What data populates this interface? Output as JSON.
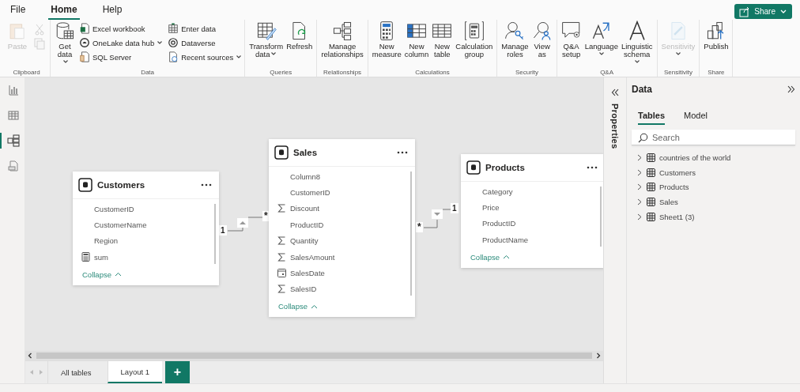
{
  "menu": [
    {
      "label": "File",
      "selected": false
    },
    {
      "label": "Home",
      "selected": true
    },
    {
      "label": "Help",
      "selected": false
    }
  ],
  "share_button": {
    "label": "Share"
  },
  "ribbon": [
    {
      "label": "Clipboard",
      "buttons": [
        {
          "kind": "large",
          "label": "Paste",
          "disabled": true,
          "dropdown": false
        },
        {
          "kind": "icon",
          "disabled": true
        },
        {
          "kind": "icon",
          "disabled": true
        }
      ]
    },
    {
      "label": "Data",
      "buttons": [
        {
          "kind": "large",
          "label": "Get data",
          "disabled": false,
          "dropdown": true
        },
        {
          "kind": "small",
          "label": "Excel workbook",
          "disabled": false,
          "dropdown": false
        },
        {
          "kind": "small",
          "label": "OneLake data hub",
          "disabled": false,
          "dropdown": true
        },
        {
          "kind": "small",
          "label": "SQL Server",
          "disabled": false,
          "dropdown": false
        },
        {
          "kind": "small",
          "label": "Enter data",
          "disabled": false,
          "dropdown": false
        },
        {
          "kind": "small",
          "label": "Dataverse",
          "disabled": false,
          "dropdown": false
        },
        {
          "kind": "small",
          "label": "Recent sources",
          "disabled": false,
          "dropdown": true
        }
      ]
    },
    {
      "label": "Queries",
      "buttons": [
        {
          "kind": "large",
          "label": "Transform data",
          "disabled": false,
          "dropdown": true
        },
        {
          "kind": "large",
          "label": "Refresh",
          "disabled": false,
          "dropdown": false
        }
      ]
    },
    {
      "label": "Relationships",
      "buttons": [
        {
          "kind": "large",
          "label": "Manage relationships",
          "disabled": false,
          "dropdown": false
        }
      ]
    },
    {
      "label": "Calculations",
      "buttons": [
        {
          "kind": "large",
          "label": "New measure",
          "disabled": false,
          "dropdown": false
        },
        {
          "kind": "large",
          "label": "New column",
          "disabled": false,
          "dropdown": false
        },
        {
          "kind": "large",
          "label": "New table",
          "disabled": false,
          "dropdown": false
        },
        {
          "kind": "large",
          "label": "Calculation group",
          "disabled": false,
          "dropdown": false
        }
      ]
    },
    {
      "label": "Security",
      "buttons": [
        {
          "kind": "large",
          "label": "Manage roles",
          "disabled": false,
          "dropdown": false
        },
        {
          "kind": "large",
          "label": "View as",
          "disabled": false,
          "dropdown": false
        }
      ]
    },
    {
      "label": "Q&A",
      "buttons": [
        {
          "kind": "large",
          "label": "Q&A setup",
          "disabled": false,
          "dropdown": false
        },
        {
          "kind": "large",
          "label": "Language",
          "disabled": false,
          "dropdown": true
        },
        {
          "kind": "large",
          "label": "Linguistic schema",
          "disabled": false,
          "dropdown": true
        }
      ]
    },
    {
      "label": "Sensitivity",
      "buttons": [
        {
          "kind": "large",
          "label": "Sensitivity",
          "disabled": true,
          "dropdown": true
        }
      ]
    },
    {
      "label": "Share",
      "buttons": [
        {
          "kind": "large",
          "label": "Publish",
          "disabled": false,
          "dropdown": false
        }
      ]
    }
  ],
  "views": [
    {
      "selected": false
    },
    {
      "selected": false
    },
    {
      "selected": true
    },
    {
      "selected": false
    }
  ],
  "tables": [
    {
      "title": "Customers",
      "fields": [
        {
          "name": "CustomerID",
          "kind": "plain"
        },
        {
          "name": "CustomerName",
          "kind": "plain"
        },
        {
          "name": "Region",
          "kind": "plain"
        },
        {
          "name": "sum",
          "kind": "measure"
        }
      ],
      "collapse": "Collapse"
    },
    {
      "title": "Sales",
      "fields": [
        {
          "name": "Column8",
          "kind": "plain"
        },
        {
          "name": "CustomerID",
          "kind": "plain"
        },
        {
          "name": "Discount",
          "kind": "sum"
        },
        {
          "name": "ProductID",
          "kind": "plain"
        },
        {
          "name": "Quantity",
          "kind": "sum"
        },
        {
          "name": "SalesAmount",
          "kind": "sum"
        },
        {
          "name": "SalesDate",
          "kind": "date"
        },
        {
          "name": "SalesID",
          "kind": "sum"
        }
      ],
      "collapse": "Collapse"
    },
    {
      "title": "Products",
      "fields": [
        {
          "name": "Category",
          "kind": "plain"
        },
        {
          "name": "Price",
          "kind": "plain"
        },
        {
          "name": "ProductID",
          "kind": "plain"
        },
        {
          "name": "ProductName",
          "kind": "plain"
        }
      ],
      "collapse": "Collapse"
    }
  ],
  "relationships": [
    {
      "one": "1",
      "many": "*",
      "points_up": true
    },
    {
      "one": "1",
      "many": "*",
      "points_up": false
    }
  ],
  "layout_tabs": [
    {
      "label": "All tables",
      "selected": false
    },
    {
      "label": "Layout 1",
      "selected": true
    }
  ],
  "add_layout": {
    "label": "+"
  },
  "properties_pane": {
    "label": "Properties"
  },
  "data_pane": {
    "title": "Data",
    "tabs": [
      {
        "label": "Tables",
        "selected": true
      },
      {
        "label": "Model",
        "selected": false
      }
    ],
    "search": {
      "placeholder": "Search"
    },
    "items": [
      {
        "label": "countries of the world",
        "expanded": false
      },
      {
        "label": "Customers",
        "expanded": false
      },
      {
        "label": "Products",
        "expanded": false
      },
      {
        "label": "Sales",
        "expanded": false
      },
      {
        "label": "Sheet1 (3)",
        "expanded": false
      }
    ]
  }
}
